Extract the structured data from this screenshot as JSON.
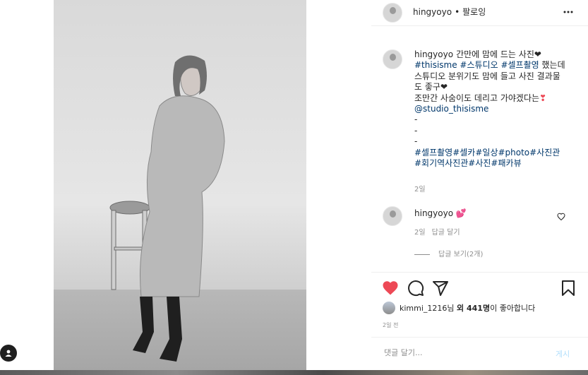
{
  "post": {
    "username": "hingyoyo",
    "separator": "•",
    "follow_status": "팔로잉",
    "more_icon": "ellipsis-icon"
  },
  "caption": {
    "username": "hingyoyo",
    "line1": "간만에 맘에 드는 사진",
    "heart1": "❤",
    "tag_line": "#thisisme #스튜디오 #셀프촬영",
    "line2": " 했는데 스튜디오 분위기도 맘에 들고 사진 결과물도 좋구",
    "heart2": "❤",
    "line3": "조만간 사숨이도 데리고 가야겠다는",
    "heart3": "❣",
    "mention": "@studio_thisisme",
    "dash1": "-",
    "dash2": "-",
    "dash3": "-",
    "hashtags": "#셀프촬영#셀카#일상#photo#사진관#회기역사진관#사진#패카뷰",
    "time": "2일"
  },
  "comment": {
    "username": "hingyoyo",
    "emoji": "💕",
    "time": "2일",
    "reply_label": "답글 달기",
    "view_replies": "답글 보기(2개)"
  },
  "likes": {
    "liker": "kimmi_1216",
    "suffix_pre": "님 ",
    "others": "외 441명",
    "suffix_post": "이 좋아합니다"
  },
  "date": "2일 전",
  "comment_input": {
    "placeholder": "댓글 달기...",
    "post_button": "게시"
  },
  "colors": {
    "like_red": "#ed4956",
    "link_blue": "#00376b",
    "post_disabled": "#b2dffc"
  }
}
